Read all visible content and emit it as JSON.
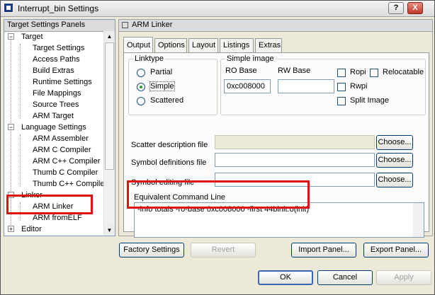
{
  "window": {
    "title": "Interrupt_bin Settings",
    "help_label": "?",
    "close_label": "X"
  },
  "left_panel": {
    "header": "Target Settings Panels",
    "items": [
      {
        "label": "Target",
        "expander": "−"
      },
      {
        "label": "Target Settings"
      },
      {
        "label": "Access Paths"
      },
      {
        "label": "Build Extras"
      },
      {
        "label": "Runtime Settings"
      },
      {
        "label": "File Mappings"
      },
      {
        "label": "Source Trees"
      },
      {
        "label": "ARM Target"
      },
      {
        "label": "Language Settings",
        "expander": "−"
      },
      {
        "label": "ARM Assembler"
      },
      {
        "label": "ARM C Compiler"
      },
      {
        "label": "ARM C++ Compiler"
      },
      {
        "label": "Thumb C Compiler"
      },
      {
        "label": "Thumb C++ Compiler"
      },
      {
        "label": "Linker",
        "expander": "−"
      },
      {
        "label": "ARM Linker"
      },
      {
        "label": "ARM fromELF"
      },
      {
        "label": "Editor",
        "expander": "+"
      }
    ],
    "scroll_up": "▲",
    "scroll_down": "▼"
  },
  "right_panel": {
    "header": "ARM Linker",
    "tabs": [
      "Output",
      "Options",
      "Layout",
      "Listings",
      "Extras"
    ],
    "active_tab": "Output",
    "linktype": {
      "label": "Linktype",
      "options": [
        "Partial",
        "Simple",
        "Scattered"
      ],
      "selected": "Simple"
    },
    "simple_image": {
      "label": "Simple image",
      "ro_base_label": "RO Base",
      "ro_base_value": "0xc008000",
      "rw_base_label": "RW Base",
      "rw_base_value": "",
      "checkboxes": [
        "Ropi",
        "Relocatable",
        "Rwpi",
        "Split Image"
      ]
    },
    "scatter_label": "Scatter description file",
    "symbol_def_label": "Symbol definitions file",
    "symbol_edit_label": "Symbol editing file",
    "choose_label": "Choose...",
    "cmdline": {
      "label": "Equivalent Command Line",
      "value": "-info totals -ro-base 0xc008000 -first 44binit.o(init)"
    }
  },
  "buttons": {
    "factory": "Factory Settings",
    "revert": "Revert",
    "import": "Import Panel...",
    "export": "Export Panel...",
    "ok": "OK",
    "cancel": "Cancel",
    "apply": "Apply"
  },
  "highlight_color": "#e01010"
}
